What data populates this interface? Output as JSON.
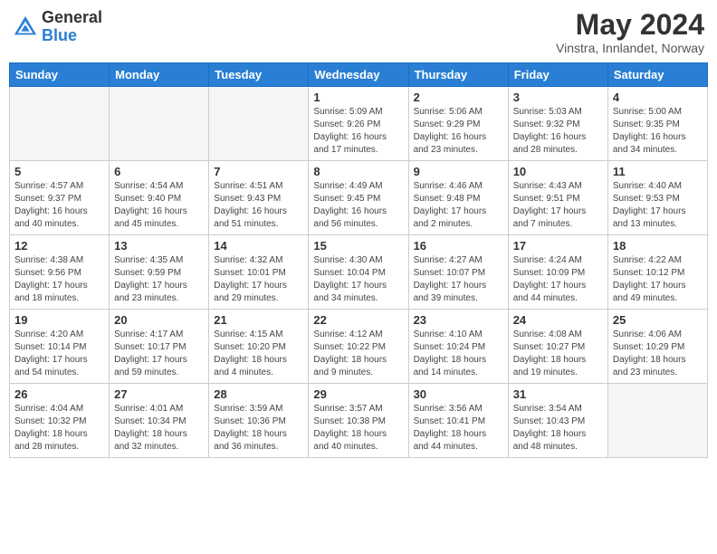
{
  "header": {
    "logo_general": "General",
    "logo_blue": "Blue",
    "month_title": "May 2024",
    "location": "Vinstra, Innlandet, Norway"
  },
  "weekdays": [
    "Sunday",
    "Monday",
    "Tuesday",
    "Wednesday",
    "Thursday",
    "Friday",
    "Saturday"
  ],
  "weeks": [
    [
      {
        "day": "",
        "empty": true
      },
      {
        "day": "",
        "empty": true
      },
      {
        "day": "",
        "empty": true
      },
      {
        "day": "1",
        "sunrise": "5:09 AM",
        "sunset": "9:26 PM",
        "daylight": "16 hours and 17 minutes."
      },
      {
        "day": "2",
        "sunrise": "5:06 AM",
        "sunset": "9:29 PM",
        "daylight": "16 hours and 23 minutes."
      },
      {
        "day": "3",
        "sunrise": "5:03 AM",
        "sunset": "9:32 PM",
        "daylight": "16 hours and 28 minutes."
      },
      {
        "day": "4",
        "sunrise": "5:00 AM",
        "sunset": "9:35 PM",
        "daylight": "16 hours and 34 minutes."
      }
    ],
    [
      {
        "day": "5",
        "sunrise": "4:57 AM",
        "sunset": "9:37 PM",
        "daylight": "16 hours and 40 minutes."
      },
      {
        "day": "6",
        "sunrise": "4:54 AM",
        "sunset": "9:40 PM",
        "daylight": "16 hours and 45 minutes."
      },
      {
        "day": "7",
        "sunrise": "4:51 AM",
        "sunset": "9:43 PM",
        "daylight": "16 hours and 51 minutes."
      },
      {
        "day": "8",
        "sunrise": "4:49 AM",
        "sunset": "9:45 PM",
        "daylight": "16 hours and 56 minutes."
      },
      {
        "day": "9",
        "sunrise": "4:46 AM",
        "sunset": "9:48 PM",
        "daylight": "17 hours and 2 minutes."
      },
      {
        "day": "10",
        "sunrise": "4:43 AM",
        "sunset": "9:51 PM",
        "daylight": "17 hours and 7 minutes."
      },
      {
        "day": "11",
        "sunrise": "4:40 AM",
        "sunset": "9:53 PM",
        "daylight": "17 hours and 13 minutes."
      }
    ],
    [
      {
        "day": "12",
        "sunrise": "4:38 AM",
        "sunset": "9:56 PM",
        "daylight": "17 hours and 18 minutes."
      },
      {
        "day": "13",
        "sunrise": "4:35 AM",
        "sunset": "9:59 PM",
        "daylight": "17 hours and 23 minutes."
      },
      {
        "day": "14",
        "sunrise": "4:32 AM",
        "sunset": "10:01 PM",
        "daylight": "17 hours and 29 minutes."
      },
      {
        "day": "15",
        "sunrise": "4:30 AM",
        "sunset": "10:04 PM",
        "daylight": "17 hours and 34 minutes."
      },
      {
        "day": "16",
        "sunrise": "4:27 AM",
        "sunset": "10:07 PM",
        "daylight": "17 hours and 39 minutes."
      },
      {
        "day": "17",
        "sunrise": "4:24 AM",
        "sunset": "10:09 PM",
        "daylight": "17 hours and 44 minutes."
      },
      {
        "day": "18",
        "sunrise": "4:22 AM",
        "sunset": "10:12 PM",
        "daylight": "17 hours and 49 minutes."
      }
    ],
    [
      {
        "day": "19",
        "sunrise": "4:20 AM",
        "sunset": "10:14 PM",
        "daylight": "17 hours and 54 minutes."
      },
      {
        "day": "20",
        "sunrise": "4:17 AM",
        "sunset": "10:17 PM",
        "daylight": "17 hours and 59 minutes."
      },
      {
        "day": "21",
        "sunrise": "4:15 AM",
        "sunset": "10:20 PM",
        "daylight": "18 hours and 4 minutes."
      },
      {
        "day": "22",
        "sunrise": "4:12 AM",
        "sunset": "10:22 PM",
        "daylight": "18 hours and 9 minutes."
      },
      {
        "day": "23",
        "sunrise": "4:10 AM",
        "sunset": "10:24 PM",
        "daylight": "18 hours and 14 minutes."
      },
      {
        "day": "24",
        "sunrise": "4:08 AM",
        "sunset": "10:27 PM",
        "daylight": "18 hours and 19 minutes."
      },
      {
        "day": "25",
        "sunrise": "4:06 AM",
        "sunset": "10:29 PM",
        "daylight": "18 hours and 23 minutes."
      }
    ],
    [
      {
        "day": "26",
        "sunrise": "4:04 AM",
        "sunset": "10:32 PM",
        "daylight": "18 hours and 28 minutes."
      },
      {
        "day": "27",
        "sunrise": "4:01 AM",
        "sunset": "10:34 PM",
        "daylight": "18 hours and 32 minutes."
      },
      {
        "day": "28",
        "sunrise": "3:59 AM",
        "sunset": "10:36 PM",
        "daylight": "18 hours and 36 minutes."
      },
      {
        "day": "29",
        "sunrise": "3:57 AM",
        "sunset": "10:38 PM",
        "daylight": "18 hours and 40 minutes."
      },
      {
        "day": "30",
        "sunrise": "3:56 AM",
        "sunset": "10:41 PM",
        "daylight": "18 hours and 44 minutes."
      },
      {
        "day": "31",
        "sunrise": "3:54 AM",
        "sunset": "10:43 PM",
        "daylight": "18 hours and 48 minutes."
      },
      {
        "day": "",
        "empty": true
      }
    ]
  ]
}
